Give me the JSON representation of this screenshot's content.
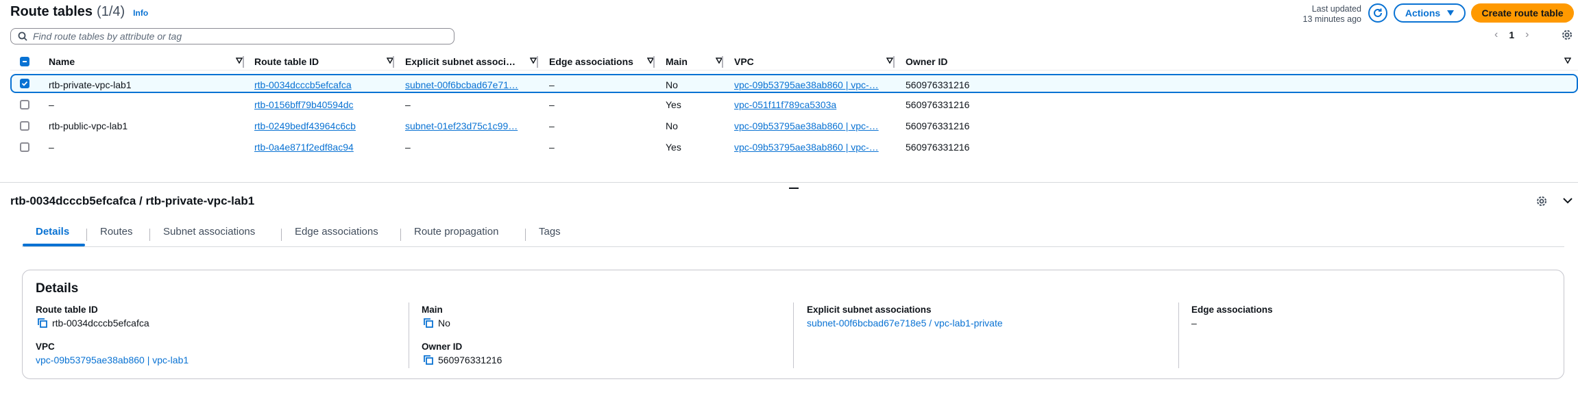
{
  "header": {
    "title": "Route tables",
    "count": "(1/4)",
    "info": "Info",
    "last_updated_line1": "Last updated",
    "last_updated_line2": "13 minutes ago",
    "actions_label": "Actions",
    "create_label": "Create route table"
  },
  "search": {
    "placeholder": "Find route tables by attribute or tag"
  },
  "pagination": {
    "page": "1"
  },
  "table": {
    "columns": [
      "Name",
      "Route table ID",
      "Explicit subnet associ…",
      "Edge associations",
      "Main",
      "VPC",
      "Owner ID"
    ],
    "rows": [
      {
        "selected": true,
        "name": "rtb-private-vpc-lab1",
        "id": "rtb-0034dcccb5efcafca",
        "subnet": "subnet-00f6bcbad67e71…",
        "edge": "–",
        "main": "No",
        "vpc": "vpc-09b53795ae38ab860 | vpc-…",
        "owner": "560976331216"
      },
      {
        "selected": false,
        "name": "–",
        "id": "rtb-0156bff79b40594dc",
        "subnet": "–",
        "edge": "–",
        "main": "Yes",
        "vpc": "vpc-051f11f789ca5303a",
        "owner": "560976331216"
      },
      {
        "selected": false,
        "name": "rtb-public-vpc-lab1",
        "id": "rtb-0249bedf43964c6cb",
        "subnet": "subnet-01ef23d75c1c99…",
        "edge": "–",
        "main": "No",
        "vpc": "vpc-09b53795ae38ab860 | vpc-…",
        "owner": "560976331216"
      },
      {
        "selected": false,
        "name": "–",
        "id": "rtb-0a4e871f2edf8ac94",
        "subnet": "–",
        "edge": "–",
        "main": "Yes",
        "vpc": "vpc-09b53795ae38ab860 | vpc-…",
        "owner": "560976331216"
      }
    ]
  },
  "detail": {
    "title": "rtb-0034dcccb5efcafca / rtb-private-vpc-lab1",
    "tabs": [
      "Details",
      "Routes",
      "Subnet associations",
      "Edge associations",
      "Route propagation",
      "Tags"
    ],
    "active_tab": "Details",
    "card_title": "Details",
    "fields": {
      "route_table_id_label": "Route table ID",
      "route_table_id": "rtb-0034dcccb5efcafca",
      "vpc_label": "VPC",
      "vpc": "vpc-09b53795ae38ab860 | vpc-lab1",
      "main_label": "Main",
      "main": "No",
      "owner_label": "Owner ID",
      "owner": "560976331216",
      "subnet_label": "Explicit subnet associations",
      "subnet": "subnet-00f6bcbad67e718e5 / vpc-lab1-private",
      "edge_label": "Edge associations",
      "edge": "–"
    }
  },
  "colors": {
    "accent": "#0972d3",
    "primary_button": "#ff9900",
    "text": "#0f141a"
  }
}
